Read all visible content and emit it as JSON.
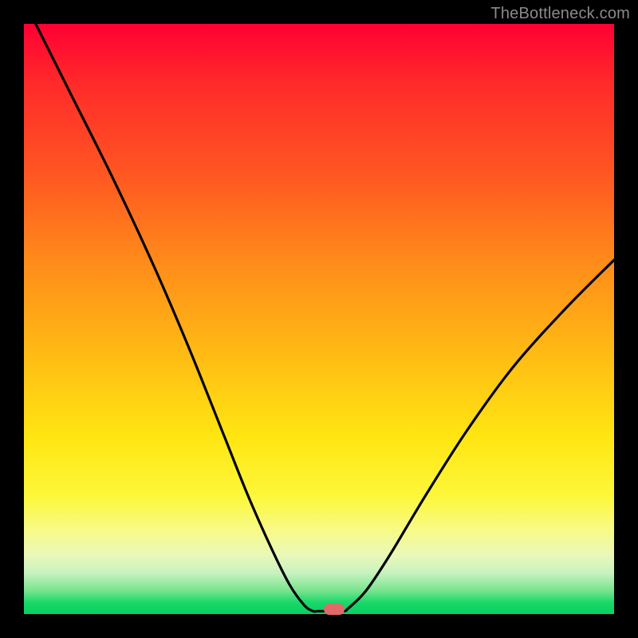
{
  "watermark": "TheBottleneck.com",
  "marker": {
    "x_frac": 0.525,
    "y_frac": 0.992
  },
  "chart_data": {
    "type": "line",
    "title": "",
    "xlabel": "",
    "ylabel": "",
    "xlim": [
      0,
      1
    ],
    "ylim": [
      0,
      1
    ],
    "series": [
      {
        "name": "bottleneck-curve",
        "x": [
          0.02,
          0.08,
          0.15,
          0.22,
          0.28,
          0.34,
          0.38,
          0.42,
          0.45,
          0.475,
          0.49,
          0.5,
          0.54,
          0.55,
          0.58,
          0.62,
          0.68,
          0.75,
          0.83,
          0.92,
          1.0
        ],
        "y": [
          1.0,
          0.88,
          0.74,
          0.59,
          0.45,
          0.3,
          0.2,
          0.11,
          0.05,
          0.015,
          0.005,
          0.005,
          0.005,
          0.01,
          0.04,
          0.1,
          0.2,
          0.31,
          0.42,
          0.52,
          0.6
        ]
      }
    ],
    "annotations": [
      {
        "type": "marker",
        "x": 0.525,
        "y": 0.008,
        "label": "optimal-point"
      }
    ],
    "background_gradient": {
      "top_color": "#ff0033",
      "bottom_color": "#05d060",
      "meaning": "red=high bottleneck, green=low bottleneck"
    }
  }
}
